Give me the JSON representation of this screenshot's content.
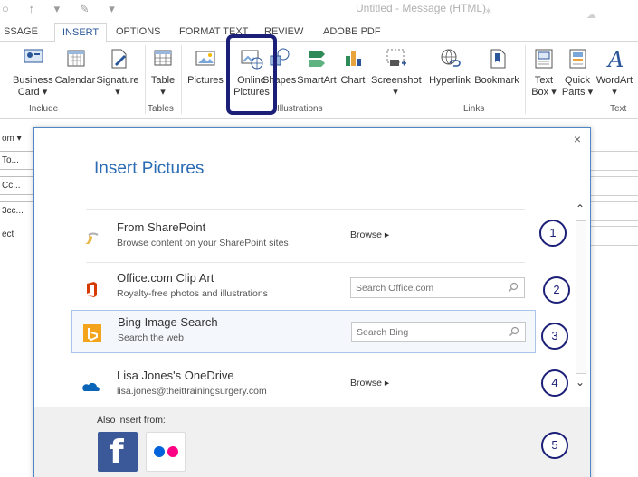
{
  "window": {
    "title": "Untitled - Message (HTML)"
  },
  "tabs": [
    {
      "label": "SSAGE"
    },
    {
      "label": "INSERT"
    },
    {
      "label": "OPTIONS"
    },
    {
      "label": "FORMAT TEXT"
    },
    {
      "label": "REVIEW"
    },
    {
      "label": "ADOBE PDF"
    }
  ],
  "ribbon": {
    "buttons": [
      {
        "label": "Business Card",
        "arrow": "▾"
      },
      {
        "label": "Calendar"
      },
      {
        "label": "Signature",
        "arrow": "▾"
      },
      {
        "label": "Table",
        "arrow": "▾"
      },
      {
        "label": "Pictures"
      },
      {
        "label": "Online Pictures"
      },
      {
        "label": "Shapes"
      },
      {
        "label": "SmartArt"
      },
      {
        "label": "Chart"
      },
      {
        "label": "Screenshot",
        "arrow": "▾"
      },
      {
        "label": "Hyperlink"
      },
      {
        "label": "Bookmark"
      },
      {
        "label": "Text Box",
        "arrow": "▾"
      },
      {
        "label": "Quick Parts",
        "arrow": "▾"
      },
      {
        "label": "WordArt",
        "arrow": "▾"
      }
    ],
    "groups": [
      "Include",
      "Tables",
      "Illustrations",
      "Links",
      "Text"
    ]
  },
  "form": {
    "rows": [
      "om ▾",
      "To...",
      "Cc...",
      "3cc...",
      "ect"
    ]
  },
  "dialog": {
    "title": "Insert Pictures",
    "close": "×",
    "rows": [
      {
        "title": "From SharePoint",
        "subtitle": "Browse content on your SharePoint sites",
        "action": "Browse ▸"
      },
      {
        "title": "Office.com Clip Art",
        "subtitle": "Royalty-free photos and illustrations",
        "placeholder": "Search Office.com"
      },
      {
        "title": "Bing Image Search",
        "subtitle": "Search the web",
        "placeholder": "Search Bing"
      },
      {
        "title": "Lisa Jones's OneDrive",
        "subtitle": "lisa.jones@theittrainingsurgery.com",
        "action": "Browse ▸"
      }
    ],
    "also_label": "Also insert from:",
    "also_icons": [
      "facebook-icon",
      "flickr-icon"
    ]
  },
  "callouts": [
    "1",
    "2",
    "3",
    "4",
    "5"
  ],
  "colors": {
    "accent": "#2b579a",
    "callout": "#1b1f77",
    "facebook": "#3b5998",
    "flickr_blue": "#0063dc",
    "flickr_pink": "#ff0084",
    "office": "#d83b01",
    "bing": "#f4a31c",
    "onedrive": "#0a64b8"
  }
}
